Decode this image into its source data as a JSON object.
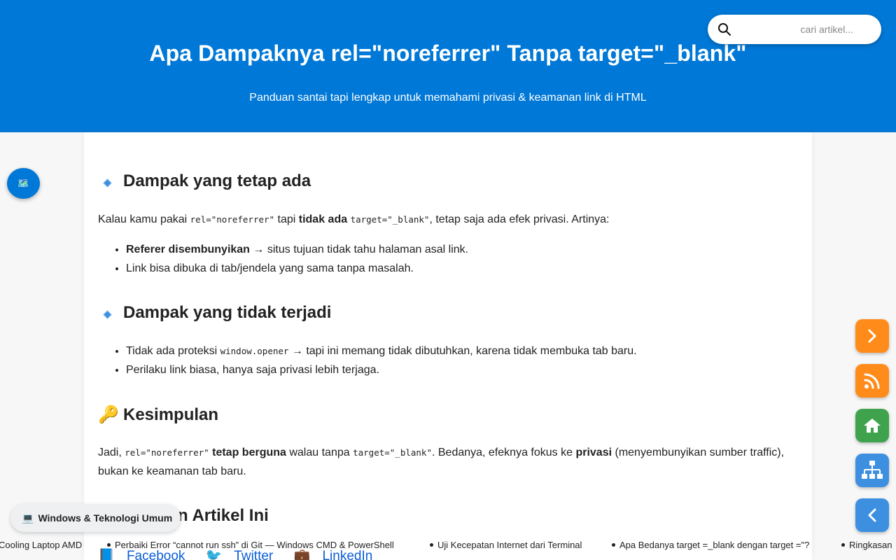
{
  "header": {
    "title": "Apa Dampaknya rel=\"noreferrer\" Tanpa target=\"_blank\"",
    "subtitle": "Panduan santai tapi lengkap untuk memahami privasi & keamanan link di HTML"
  },
  "search": {
    "placeholder": "cari artikel..."
  },
  "sections": {
    "s1": {
      "heading": "Dampak yang tetap ada",
      "intro_pre": "Kalau kamu pakai ",
      "intro_code1": "rel=\"noreferrer\"",
      "intro_mid": " tapi ",
      "intro_bold": "tidak ada",
      "intro_code2": "target=\"_blank\"",
      "intro_post": ", tetap saja ada efek privasi. Artinya:",
      "b1_bold": "Referer disembunyikan",
      "b1_rest": " → situs tujuan tidak tahu halaman asal link.",
      "b2": "Link bisa dibuka di tab/jendela yang sama tanpa masalah."
    },
    "s2": {
      "heading": "Dampak yang tidak terjadi",
      "b1_pre": "Tidak ada proteksi ",
      "b1_code": "window.opener",
      "b1_post": " → tapi ini memang tidak dibutuhkan, karena tidak membuka tab baru.",
      "b2": "Perilaku link biasa, hanya saja privasi lebih terjaga."
    },
    "s3": {
      "icon": "🔑",
      "heading": "Kesimpulan",
      "p_pre": "Jadi, ",
      "p_code1": "rel=\"noreferrer\"",
      "p_bold1": " tetap berguna",
      "p_mid": " walau tanpa ",
      "p_code2": "target=\"_blank\"",
      "p_mid2": ". Bedanya, efeknya fokus ke ",
      "p_bold2": "privasi",
      "p_post": " (menyembunyikan sumber traffic), bukan ke keamanan tab baru."
    },
    "s4": {
      "heading_visible": "n Artikel Ini"
    }
  },
  "social": [
    {
      "icon": "📘",
      "label": "Facebook"
    },
    {
      "icon": "🐦",
      "label": "Twitter"
    },
    {
      "icon": "💼",
      "label": "LinkedIn"
    }
  ],
  "category_pill": {
    "icon": "💻",
    "label": "Windows & Teknologi Umum"
  },
  "toc_button": {
    "icon": "🗺️"
  },
  "ticker": [
    "Cooling Laptop AMD",
    "Perbaiki Error “cannot run ssh” di Git — Windows CMD & PowerShell",
    "Uji Kecepatan Internet dari Terminal",
    "Apa Bedanya target =_blank dengan target =\"?",
    "Ringkasan"
  ],
  "side_buttons": [
    {
      "name": "next",
      "icon": "chevron-right-icon",
      "color": "#ff8c1a"
    },
    {
      "name": "rss",
      "icon": "rss-icon",
      "color": "#ff8c1a"
    },
    {
      "name": "home",
      "icon": "home-icon",
      "color": "#3fa34d"
    },
    {
      "name": "sitemap",
      "icon": "sitemap-icon",
      "color": "#3d8fe0"
    },
    {
      "name": "prev",
      "icon": "chevron-left-icon",
      "color": "#3d8fe0"
    }
  ],
  "colors": {
    "header_bg": "#0078d7",
    "accent_orange": "#ff8c1a",
    "accent_green": "#3fa34d",
    "accent_blue": "#3d8fe0"
  }
}
